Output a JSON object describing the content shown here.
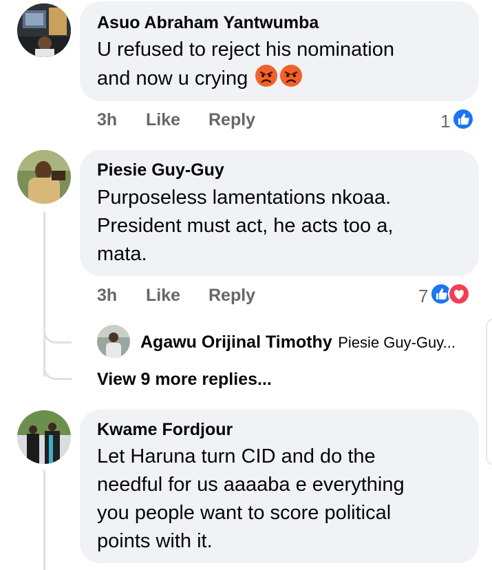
{
  "comments": [
    {
      "author": "Asuo Abraham Yantwumba",
      "lines": [
        "U refused  to reject his nomination",
        "and now u crying"
      ],
      "emojis": [
        "angry-face",
        "angry-face"
      ],
      "time": "3h",
      "like": "Like",
      "reply": "Reply",
      "reaction_count": "1",
      "reactions": [
        "like"
      ]
    },
    {
      "author": "Piesie Guy-Guy",
      "lines": [
        "Purposeless lamentations nkoaa.",
        "President must act, he acts too a,",
        "mata."
      ],
      "time": "3h",
      "like": "Like",
      "reply": "Reply",
      "reaction_count": "7",
      "reactions": [
        "like",
        "love"
      ],
      "reply_preview": {
        "author": "Agawu Orijinal Timothy",
        "text": "Piesie Guy-Guy..."
      },
      "more_replies": "View 9 more replies..."
    },
    {
      "author": "Kwame Fordjour",
      "lines": [
        "Let Haruna turn CID and do the",
        "needful for us aaaaba e everything",
        "you people want to score political",
        "points with it."
      ]
    }
  ],
  "colors": {
    "bubble": "#f0f2f5",
    "muted_text": "#65676b",
    "like_blue": "#1877f2",
    "love_red": "#f33e58",
    "thread_line": "#dde0e4"
  }
}
